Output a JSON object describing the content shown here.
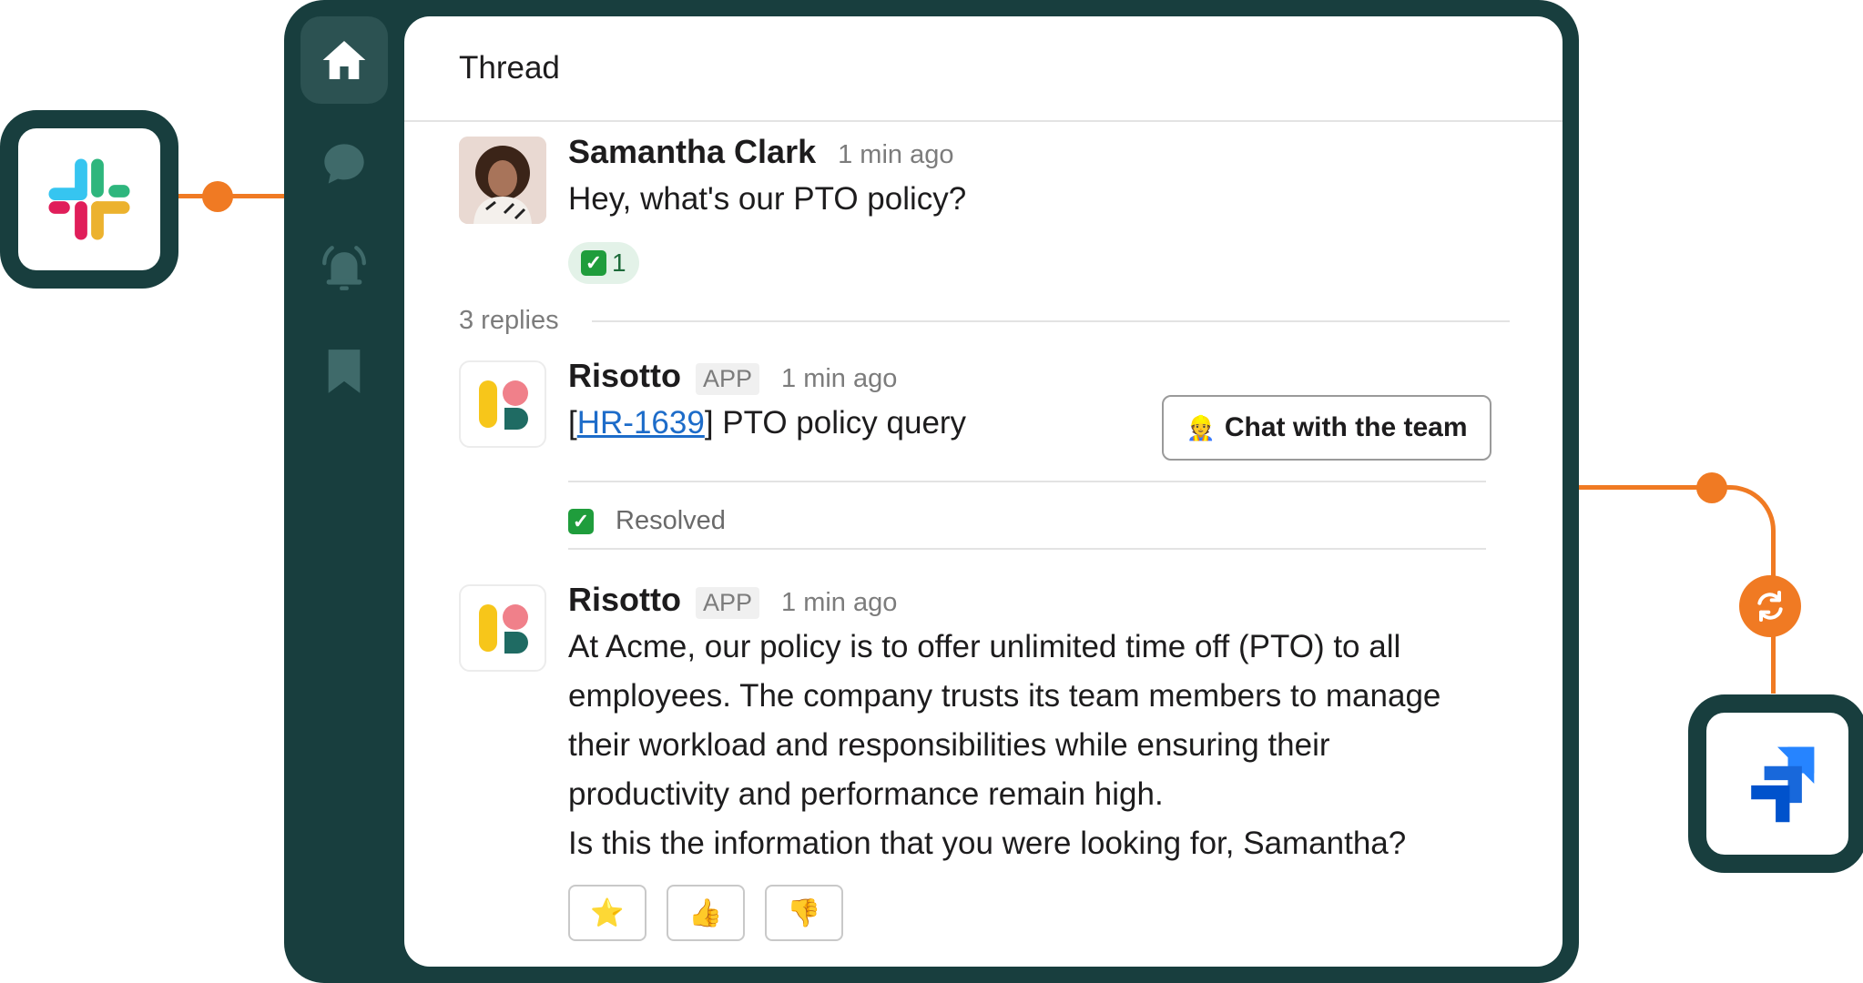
{
  "thread": {
    "title": "Thread",
    "replies_label": "3 replies"
  },
  "sidebar": {
    "items": [
      {
        "icon": "home-icon",
        "active": true
      },
      {
        "icon": "chat-bubble-icon",
        "active": false
      },
      {
        "icon": "bell-icon",
        "active": false
      },
      {
        "icon": "bookmark-icon",
        "active": false
      }
    ]
  },
  "messages": [
    {
      "author": "Samantha Clark",
      "time": "1 min ago",
      "text": "Hey, what's our PTO policy?",
      "reaction": {
        "emoji": "✅",
        "count": "1"
      }
    },
    {
      "author": "Risotto",
      "badge": "APP",
      "time": "1 min ago",
      "text_prefix": "[",
      "ticket": "HR-1639",
      "text_suffix": "] PTO policy query",
      "button": {
        "emoji": "👷",
        "label": "Chat with the team"
      },
      "status": "Resolved"
    },
    {
      "author": "Risotto",
      "badge": "APP",
      "time": "1 min ago",
      "lines": [
        "At Acme, our policy is to offer unlimited time off (PTO) to all",
        "employees. The company trusts its team members to manage",
        "their workload and responsibilities while ensuring their",
        "productivity and performance remain high.",
        "Is this the information that you were looking for, Samantha?"
      ],
      "feedback": [
        {
          "emoji": "⭐",
          "name": "star"
        },
        {
          "emoji": "👍",
          "name": "thumbs-up"
        },
        {
          "emoji": "👎",
          "name": "thumbs-down"
        }
      ]
    }
  ],
  "integrations": {
    "left": "slack-logo",
    "right": "jira-logo",
    "sync": "sync-icon"
  },
  "colors": {
    "frame": "#183e3e",
    "accent": "#f07a23",
    "link": "#1d6cc9",
    "success": "#1f9d3c"
  }
}
